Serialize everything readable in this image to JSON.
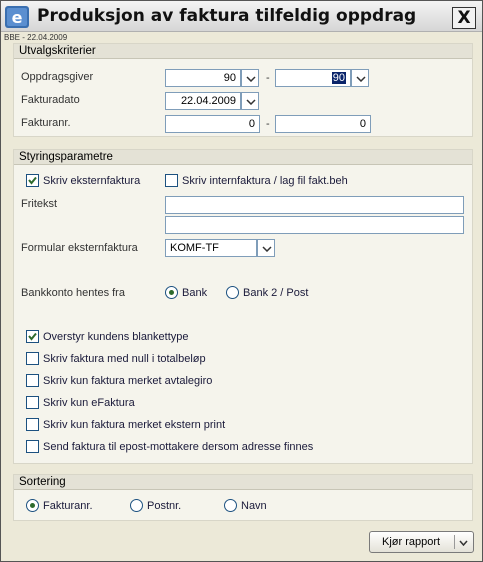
{
  "window": {
    "title": "Produksjon av faktura tilfeldig oppdrag",
    "subtitle": "BBE - 22.04.2009",
    "close_glyph": "X"
  },
  "utvalg": {
    "header": "Utvalgskriterier",
    "oppdragsgiver_label": "Oppdragsgiver",
    "oppdragsgiver_from": "90",
    "oppdragsgiver_to": "90",
    "fakturadato_label": "Fakturadato",
    "fakturadato_value": "22.04.2009",
    "fakturanr_label": "Fakturanr.",
    "fakturanr_from": "0",
    "fakturanr_to": "0",
    "dash": "-"
  },
  "styring": {
    "header": "Styringsparametre",
    "skriv_ekstern_label": "Skriv eksternfaktura",
    "skriv_ekstern_checked": true,
    "skriv_intern_label": "Skriv internfaktura / lag fil fakt.beh",
    "skriv_intern_checked": false,
    "fritekst_label": "Fritekst",
    "fritekst_line1": "",
    "fritekst_line2": "",
    "formular_label": "Formular eksternfaktura",
    "formular_value": "KOMF-TF",
    "bankkonto_label": "Bankkonto hentes fra",
    "bank_options": [
      {
        "label": "Bank",
        "selected": true
      },
      {
        "label": "Bank 2 / Post",
        "selected": false
      }
    ],
    "checkboxes": [
      {
        "label": "Overstyr kundens blankettype",
        "checked": true
      },
      {
        "label": "Skriv faktura med null i totalbeløp",
        "checked": false
      },
      {
        "label": "Skriv kun faktura merket avtalegiro",
        "checked": false
      },
      {
        "label": "Skriv kun eFaktura",
        "checked": false
      },
      {
        "label": "Skriv kun faktura merket ekstern print",
        "checked": false
      },
      {
        "label": "Send faktura til epost-mottakere dersom adresse finnes",
        "checked": false
      }
    ]
  },
  "sortering": {
    "header": "Sortering",
    "options": [
      {
        "label": "Fakturanr.",
        "selected": true
      },
      {
        "label": "Postnr.",
        "selected": false
      },
      {
        "label": "Navn",
        "selected": false
      }
    ]
  },
  "footer": {
    "run_label": "Kjør rapport"
  },
  "colors": {
    "field_border": "#7f9db9",
    "checkbox_border": "#1c5180",
    "check_mark": "#2d6a2d",
    "selection": "#0a246a"
  }
}
